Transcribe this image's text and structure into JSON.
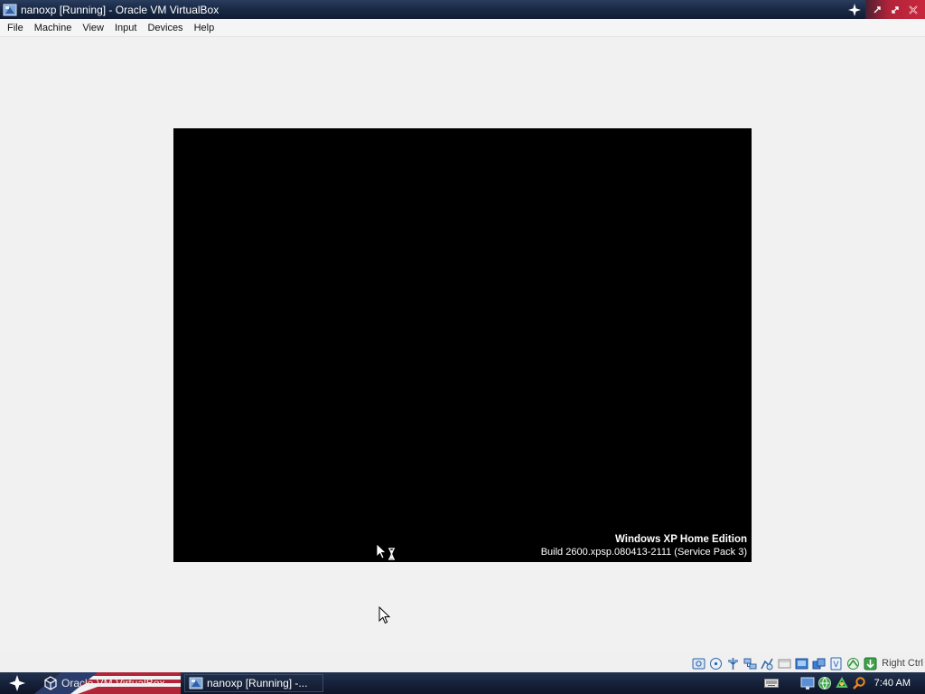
{
  "window": {
    "title": "nanoxp [Running] - Oracle VM VirtualBox"
  },
  "menubar": {
    "items": [
      "File",
      "Machine",
      "View",
      "Input",
      "Devices",
      "Help"
    ]
  },
  "vm_screen": {
    "edition": "Windows XP Home Edition",
    "build": "Build 2600.xpsp.080413-2111 (Service Pack 3)"
  },
  "statusbar": {
    "indicators": [
      "hard-disk-icon",
      "optical-drive-icon",
      "usb-icon",
      "network-icon",
      "shared-folders-icon",
      "display-icon",
      "video-capture-icon",
      "mouse-integration-icon",
      "virtualization-icon",
      "keyboard-capture-icon",
      "additions-icon"
    ],
    "host_key": "Right Ctrl"
  },
  "taskbar": {
    "tasks": [
      {
        "label": "Oracle VM VirtualBox",
        "icon": "virtualbox-cube-icon"
      },
      {
        "label": "nanoxp [Running] -...",
        "icon": "vm-window-icon"
      }
    ],
    "tray_icons": [
      "keyboard-icon",
      "monitor-icon",
      "network-icon",
      "recycle-icon",
      "search-icon"
    ],
    "clock": "7:40 AM"
  },
  "colors": {
    "titlebar": "#1a2a47",
    "titlebar_buttons": "#c8283e",
    "vm_screen": "#000000",
    "background": "#f1f1f1"
  }
}
